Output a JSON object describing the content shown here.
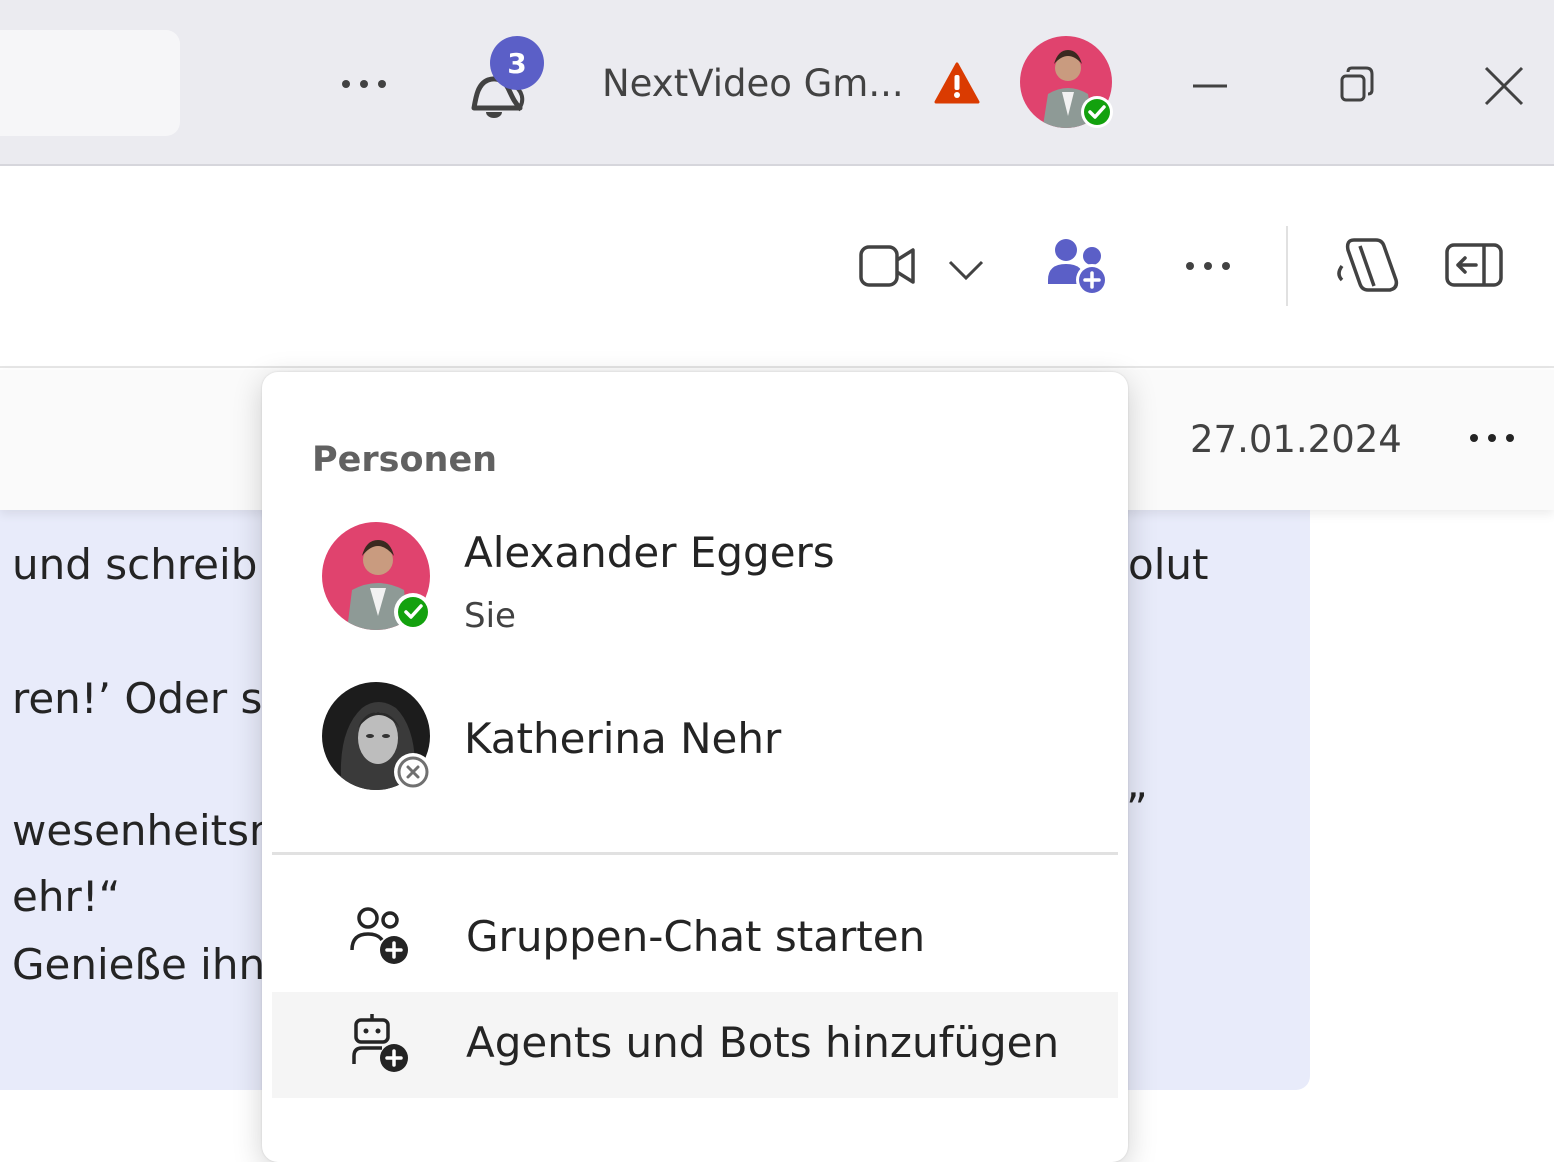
{
  "titlebar": {
    "notifications_count": "3",
    "org_name": "NextVideo Gm...",
    "icons": {
      "more": "more-horizontal-icon",
      "notifications": "bell-icon",
      "warning": "warning-triangle-icon",
      "minimize": "minimize-icon",
      "restore": "restore-icon",
      "close": "close-icon"
    }
  },
  "header": {
    "icons": [
      "video-camera-icon",
      "chevron-down-icon",
      "add-people-icon",
      "more-horizontal-icon",
      "copilot-icon",
      "panel-collapse-icon"
    ]
  },
  "message": {
    "date": "27.01.2024",
    "fragments": [
      "und schreib",
      "ren!’ Oder s",
      "wesenheitsn",
      "ehr!“",
      "Genieße ihn!",
      "olut",
      "”"
    ]
  },
  "popup": {
    "section_title": "Personen",
    "people": [
      {
        "name": "Alexander Eggers",
        "subtitle": "Sie",
        "status": "available"
      },
      {
        "name": "Katherina Nehr",
        "subtitle": "",
        "status": "offline"
      }
    ],
    "actions": [
      {
        "label": "Gruppen-Chat starten",
        "icon": "group-add-icon"
      },
      {
        "label": "Agents und Bots hinzufügen",
        "icon": "bot-add-icon"
      }
    ]
  },
  "colors": {
    "accent": "#5b5fc7",
    "available": "#13a10e",
    "warning": "#da3b01",
    "bubble": "#e8ebfa"
  }
}
